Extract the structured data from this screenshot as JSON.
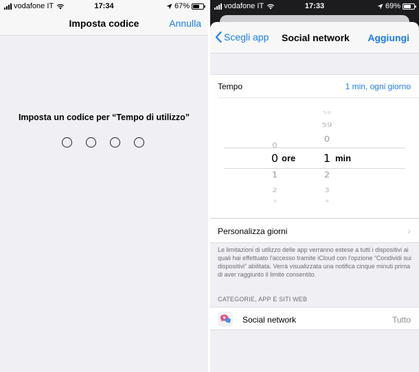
{
  "left_screen": {
    "status_bar": {
      "carrier": "vodafone IT",
      "time": "17:34",
      "battery": "67%",
      "battery_level": 0.67
    },
    "navbar": {
      "title": "Imposta codice",
      "cancel_label": "Annulla"
    },
    "prompt": "Imposta un codice per “Tempo di utilizzo”",
    "passcode_length": 4
  },
  "right_screen": {
    "status_bar": {
      "carrier": "vodafone IT",
      "time": "17:33",
      "battery": "69%",
      "battery_level": 0.69
    },
    "navbar": {
      "back_label": "Scegli app",
      "title": "Social network",
      "add_label": "Aggiungi"
    },
    "time_row": {
      "label": "Tempo",
      "value": "1 min, ogni giorno"
    },
    "picker": {
      "hours": {
        "above": [
          "0"
        ],
        "selected": "0",
        "below": [
          "1",
          "2",
          "3"
        ],
        "unit": "ore"
      },
      "minutes": {
        "above": [
          "58",
          "59",
          "0"
        ],
        "selected": "1",
        "below": [
          "2",
          "3",
          "4"
        ],
        "unit": "min"
      }
    },
    "custom_days_label": "Personalizza giorni",
    "footnote": "Le limitazioni di utilizzo delle app verranno estese a tutti i dispositivi ai quali hai effettuato l'accesso tramite iCloud con l'opzione “Condividi sui dispositivi” abilitata. Verrà visualizzata una notifica cinque minuti prima di aver raggiunto il limite consentito.",
    "section_header": "CATEGORIE, APP E SITI WEB",
    "category": {
      "label": "Social network",
      "value": "Tutto",
      "icon": "social-network-icon"
    }
  },
  "colors": {
    "accent": "#1a7cf2",
    "background": "#efeff4",
    "secondary_text": "#6d6d72"
  }
}
